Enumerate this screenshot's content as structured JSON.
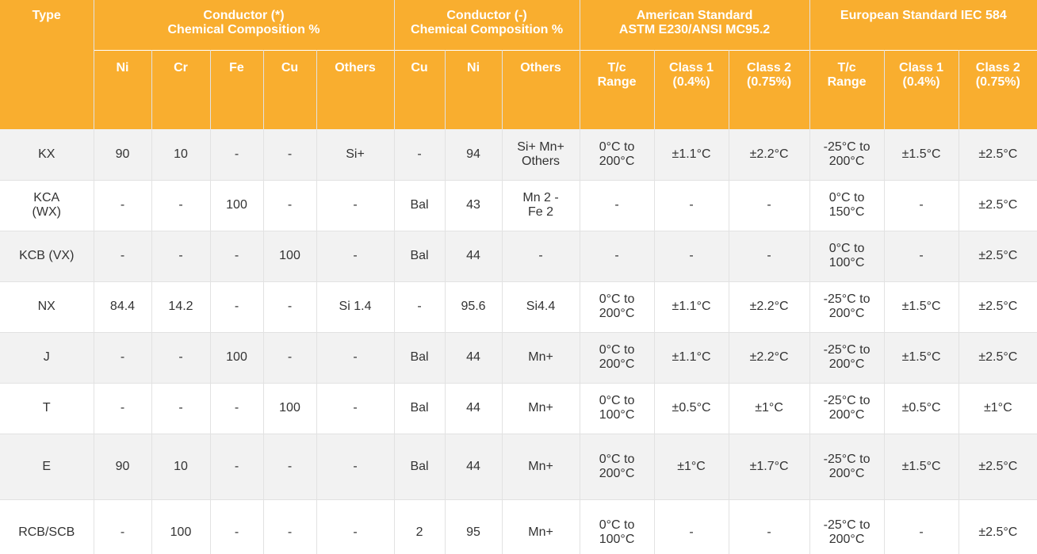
{
  "header": {
    "type": "Type",
    "groups": {
      "cond_plus": "Conductor (*)\nChemical Composition %",
      "cond_minus": "Conductor (-)\nChemical Composition %",
      "american": "American Standard\nASTM E230/ANSI MC95.2",
      "european": "European Standard IEC 584"
    },
    "sub": [
      "Ni",
      "Cr",
      "Fe",
      "Cu",
      "Others",
      "Cu",
      "Ni",
      "Others",
      "T/c\nRange",
      "Class 1\n(0.4%)",
      "Class 2\n(0.75%)",
      "T/c\nRange",
      "Class 1\n(0.4%)",
      "Class 2\n(0.75%)"
    ]
  },
  "rows": [
    [
      "KX",
      "90",
      "10",
      "-",
      "-",
      "Si+",
      "-",
      "94",
      "Si+ Mn+\nOthers",
      "0°C to\n200°C",
      "±1.1°C",
      "±2.2°C",
      "-25°C to\n200°C",
      "±1.5°C",
      "±2.5°C"
    ],
    [
      "KCA\n(WX)",
      "-",
      "-",
      "100",
      "-",
      "-",
      "Bal",
      "43",
      "Mn 2 -\nFe 2",
      "-",
      "-",
      "-",
      "0°C to\n150°C",
      "-",
      "±2.5°C"
    ],
    [
      "KCB (VX)",
      "-",
      "-",
      "-",
      "100",
      "-",
      "Bal",
      "44",
      "-",
      "-",
      "-",
      "-",
      "0°C to\n100°C",
      "-",
      "±2.5°C"
    ],
    [
      "NX",
      "84.4",
      "14.2",
      "-",
      "-",
      "Si 1.4",
      "-",
      "95.6",
      "Si4.4",
      "0°C to\n200°C",
      "±1.1°C",
      "±2.2°C",
      "-25°C to\n200°C",
      "±1.5°C",
      "±2.5°C"
    ],
    [
      "J",
      "-",
      "-",
      "100",
      "-",
      "-",
      "Bal",
      "44",
      "Mn+",
      "0°C to\n200°C",
      "±1.1°C",
      "±2.2°C",
      "-25°C to\n200°C",
      "±1.5°C",
      "±2.5°C"
    ],
    [
      "T",
      "-",
      "-",
      "-",
      "100",
      "-",
      "Bal",
      "44",
      "Mn+",
      "0°C to\n100°C",
      "±0.5°C",
      "±1°C",
      "-25°C to\n200°C",
      "±0.5°C",
      "±1°C"
    ],
    [
      "E",
      "90",
      "10",
      "-",
      "-",
      "-",
      "Bal",
      "44",
      "Mn+",
      "0°C to\n200°C",
      "±1°C",
      "±1.7°C",
      "-25°C to\n200°C",
      "±1.5°C",
      "±2.5°C"
    ],
    [
      "RCB/SCB",
      "-",
      "100",
      "-",
      "-",
      "-",
      "2",
      "95",
      "Mn+",
      "0°C to\n100°C",
      "-",
      "-",
      "-25°C to\n200°C",
      "-",
      "±2.5°C"
    ]
  ],
  "colors": {
    "header_bg": "#f9ae2f",
    "row_alt": "#f2f2f2"
  }
}
